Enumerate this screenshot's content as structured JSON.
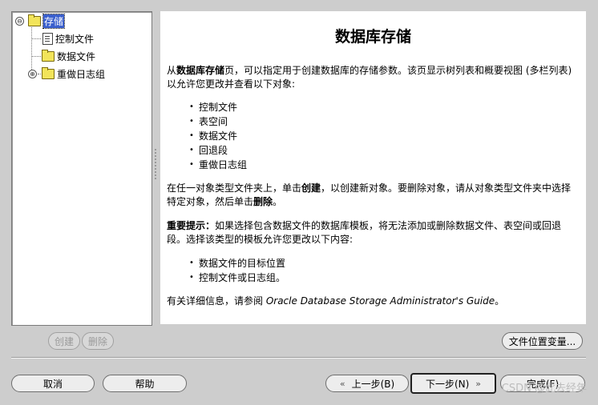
{
  "tree": {
    "root": {
      "label": "存储",
      "expander": "⊖"
    },
    "children": [
      {
        "label": "控制文件",
        "icon": "file-icon"
      },
      {
        "label": "数据文件",
        "icon": "folder-icon"
      },
      {
        "label": "重做日志组",
        "icon": "folder-icon",
        "expander": "⊕"
      }
    ]
  },
  "content": {
    "title": "数据库存储",
    "intro_prefix": "从",
    "intro_bold": "数据库存储",
    "intro_rest": "页，可以指定用于创建数据库的存储参数。该页显示树列表和概要视图 (多栏列表) 以允许您更改并查看以下对象:",
    "objects": [
      "控制文件",
      "表空间",
      "数据文件",
      "回退段",
      "重做日志组"
    ],
    "create_para_a": "在任一对象类型文件夹上，单击",
    "create_para_bold1": "创建",
    "create_para_b": "，以创建新对象。要删除对象，请从对象类型文件夹中选择特定对象，然后单击",
    "create_para_bold2": "删除",
    "create_para_c": "。",
    "important_bold": "重要提示：",
    "important_rest": "如果选择包含数据文件的数据库模板，将无法添加或删除数据文件、表空间或回退段。选择该类型的模板允许您更改以下内容:",
    "changes": [
      "数据文件的目标位置",
      "控制文件或日志组。"
    ],
    "more_info_prefix": "有关详细信息，请参阅 ",
    "more_info_guide": "Oracle Database Storage Administrator's Guide",
    "more_info_suffix": "。"
  },
  "buttons": {
    "create": "创建",
    "delete": "删除",
    "file_location_vars": "文件位置变量...",
    "cancel": "取消",
    "help": "帮助",
    "back": "上一步(B)",
    "next": "下一步(N)",
    "finish": "完成(F)"
  },
  "icons": {
    "back_chevron": "«",
    "next_chevron": "»"
  },
  "watermark": "CSDN @此去经年"
}
